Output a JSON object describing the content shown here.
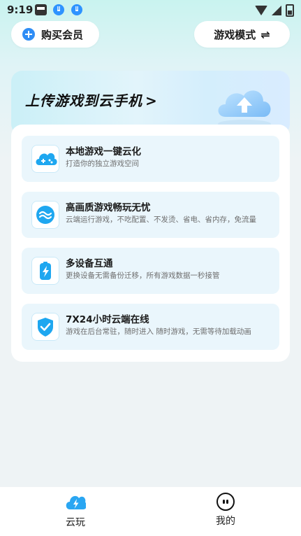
{
  "status_bar": {
    "time": "9:19"
  },
  "header": {
    "buy_member_label": "购买会员",
    "game_mode_label": "游戏模式",
    "game_mode_icon": "⇌"
  },
  "banner": {
    "title": "上传游戏到云手机",
    "arrow": ">"
  },
  "features": [
    {
      "title": "本地游戏一键云化",
      "subtitle": "打造你的独立游戏空间",
      "icon": "cloud-gamepad-icon"
    },
    {
      "title": "高画质游戏畅玩无忧",
      "subtitle": "云端运行游戏，不吃配置、不发烫、省电、省内存，免流量",
      "icon": "wave-icon"
    },
    {
      "title": "多设备互通",
      "subtitle": "更换设备无需备份迁移，所有游戏数据一秒接管",
      "icon": "battery-bolt-icon"
    },
    {
      "title": "7X24小时云端在线",
      "subtitle": "游戏在后台常驻，随时进入 随时游戏，无需等待加载动画",
      "icon": "shield-check-icon"
    }
  ],
  "bottom_nav": [
    {
      "label": "云玩",
      "icon": "cloud-bolt-icon",
      "active": true
    },
    {
      "label": "我的",
      "icon": "face-icon",
      "active": false
    }
  ],
  "colors": {
    "accent": "#2f8df5",
    "card_bg": "#eaf6fc",
    "icon_blue": "#1ea7f0"
  }
}
